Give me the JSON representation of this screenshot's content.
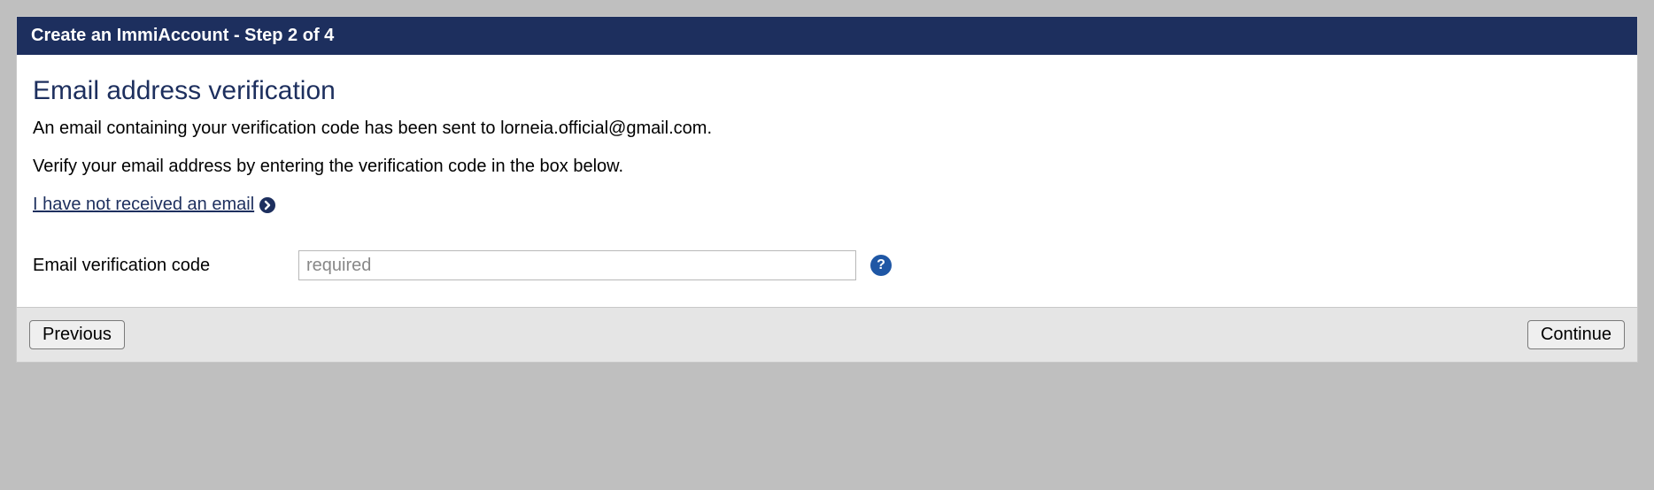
{
  "header": {
    "title": "Create an ImmiAccount - Step 2 of 4"
  },
  "main": {
    "heading": "Email address verification",
    "sent_text": "An email containing your verification code has been sent to lorneia.official@gmail.com.",
    "verify_text": "Verify your email address by entering the verification code in the box below.",
    "not_received_link": "I have not received an email"
  },
  "form": {
    "label": "Email verification code",
    "placeholder": "required",
    "value": "",
    "help_symbol": "?"
  },
  "buttons": {
    "previous": "Previous",
    "continue": "Continue"
  }
}
